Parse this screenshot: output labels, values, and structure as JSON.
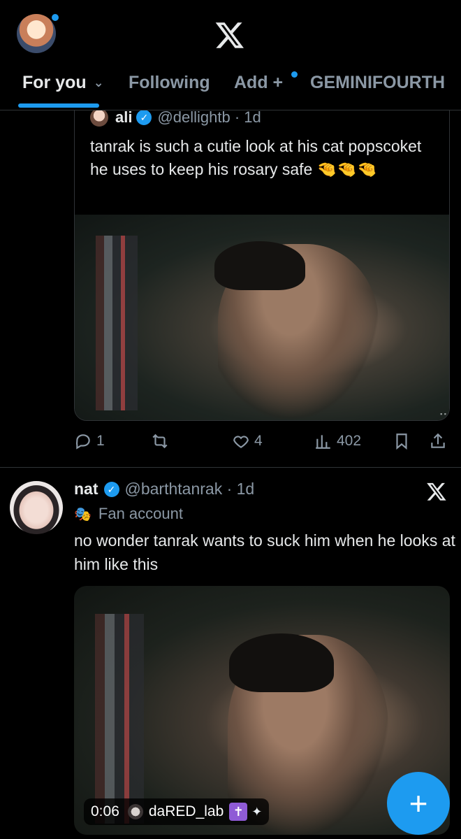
{
  "header": {
    "tabs": [
      {
        "label": "For you"
      },
      {
        "label": "Following"
      },
      {
        "label": "Add +"
      },
      {
        "label": "GEMINIFOURTH"
      }
    ]
  },
  "tweet1": {
    "quote": {
      "name": "ali",
      "handle_time": "@dellightb · 1d",
      "text": "tanrak is such  a cutie look at his cat popscoket he uses to keep his rosary safe 🤏🤏🤏"
    },
    "actions": {
      "replies": "1",
      "likes": "4",
      "views": "402"
    }
  },
  "tweet2": {
    "name": "nat",
    "handle_time": "@barthtanrak · 1d",
    "label": "Fan account",
    "text": "no wonder tanrak wants to suck him when he looks at him like this",
    "video": {
      "time": "0:06",
      "user": "daRED_lab",
      "badge": "✝️",
      "wing": "🪽"
    }
  },
  "fab": {
    "label": "+"
  },
  "colors": {
    "accent": "#1d9bf0",
    "muted": "#8b98a5",
    "text": "#e7e9ea",
    "border": "#2f3336"
  }
}
